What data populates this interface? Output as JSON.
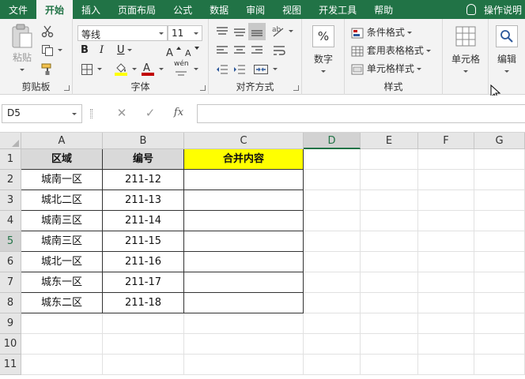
{
  "ribbon_tabs": [
    "文件",
    "开始",
    "插入",
    "页面布局",
    "公式",
    "数据",
    "审阅",
    "视图",
    "开发工具",
    "帮助"
  ],
  "active_tab": "开始",
  "tell_me": "操作说明",
  "clipboard": {
    "paste": "粘贴",
    "label": "剪贴板"
  },
  "font": {
    "name": "等线",
    "size": "11",
    "bold": "B",
    "italic": "I",
    "underline": "U",
    "label": "字体",
    "phonetic": "wén"
  },
  "alignment": {
    "label": "对齐方式"
  },
  "number": {
    "button": "数字",
    "symbol": "%"
  },
  "styles": {
    "conditional": "条件格式",
    "table": "套用表格格式",
    "cell": "单元格样式",
    "label": "样式"
  },
  "cells": {
    "button": "单元格"
  },
  "editing": {
    "button": "编辑"
  },
  "formula_bar": {
    "name_box": "D5",
    "fx": "fx",
    "value": ""
  },
  "columns": [
    "A",
    "B",
    "C",
    "D",
    "E",
    "F",
    "G"
  ],
  "selected_column": "D",
  "rows": [
    "1",
    "2",
    "3",
    "4",
    "5",
    "6",
    "7",
    "8",
    "9",
    "10",
    "11"
  ],
  "selected_row": "5",
  "table": {
    "headers": [
      "区域",
      "编号",
      "合并内容"
    ],
    "rows": [
      [
        "城南一区",
        "211-12",
        ""
      ],
      [
        "城北二区",
        "211-13",
        ""
      ],
      [
        "城南三区",
        "211-14",
        ""
      ],
      [
        "城南三区",
        "211-15",
        ""
      ],
      [
        "城北一区",
        "211-16",
        ""
      ],
      [
        "城东一区",
        "211-17",
        ""
      ],
      [
        "城东二区",
        "211-18",
        ""
      ]
    ]
  },
  "colors": {
    "accent": "#217346",
    "header_fill": "#d9d9d9",
    "highlight_fill": "#ffff00",
    "font_color_bar": "#c00000",
    "fill_color_bar": "#ffff00"
  }
}
